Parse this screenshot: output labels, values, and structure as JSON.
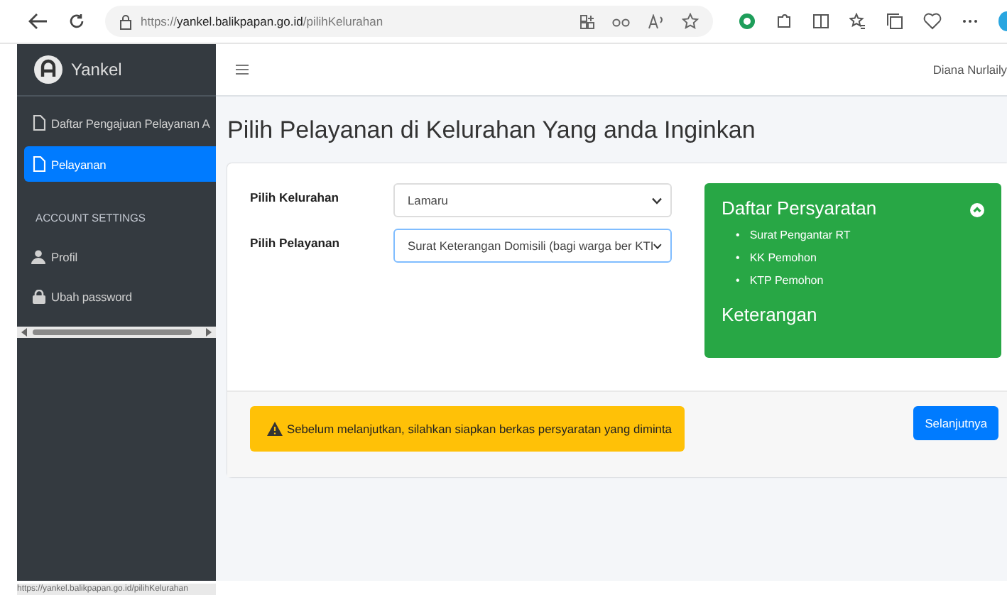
{
  "browser": {
    "url": "https://**yankel.balikpapan.go.id**/pilihKelurahan"
  },
  "sidebar": {
    "brand": "Yankel",
    "items": [
      {
        "kind": "page",
        "label": "Daftar Pengajuan Pelayanan A",
        "selected": false
      },
      {
        "kind": "page",
        "label": "Pelayanan",
        "selected": true
      },
      {
        "kind": "header",
        "label": "ACCOUNT SETTINGS"
      },
      {
        "kind": "profile",
        "label": "Profil",
        "selected": false
      },
      {
        "kind": "password",
        "label": "Ubah password",
        "selected": false
      }
    ]
  },
  "navbar": {
    "user": "Diana Nurlaily"
  },
  "page_title": "Pilih Pelayanan di Kelurahan Yang anda Inginkan",
  "form": {
    "fields": [
      {
        "label": "Pilih Kelurahan",
        "value": "Lamaru",
        "focused": false
      },
      {
        "label": "Pilih Pelayanan",
        "value": "Surat Keterangan Domisili (bagi warga ber KTI",
        "focused": true
      }
    ]
  },
  "requirements": {
    "title": "Daftar Persyaratan",
    "bullet": "•",
    "items": [
      "Surat Pengantar RT",
      "KK Pemohon",
      "KTP Pemohon"
    ],
    "note_title": "Keterangan"
  },
  "alert": "Sebelum melanjutkan, silahkan siapkan berkas persyaratan yang diminta",
  "next_button": "Selanjutnya",
  "status_bar": "https://yankel.balikpapan.go.id/pilihKelurahan"
}
